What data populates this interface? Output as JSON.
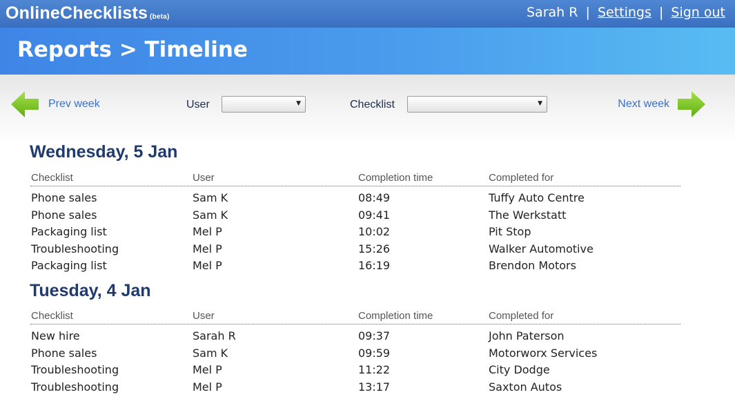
{
  "app": {
    "name": "OnlineChecklists",
    "badge": "(beta)"
  },
  "user_nav": {
    "user": "Sarah R",
    "separator": "|",
    "settings": "Settings",
    "sign_out": "Sign out"
  },
  "page_title": "Reports > Timeline",
  "toolbar": {
    "prev_label": "Prev week",
    "next_label": "Next week",
    "user_label": "User",
    "user_value": "",
    "checklist_label": "Checklist",
    "checklist_value": ""
  },
  "columns": [
    "Checklist",
    "User",
    "Completion time",
    "Completed for"
  ],
  "days": [
    {
      "title": "Wednesday, 5 Jan",
      "rows": [
        [
          "Phone sales",
          "Sam K",
          "08:49",
          "Tuffy Auto Centre"
        ],
        [
          "Phone sales",
          "Sam K",
          "09:41",
          "The Werkstatt"
        ],
        [
          "Packaging list",
          "Mel P",
          "10:02",
          "Pit Stop"
        ],
        [
          "Troubleshooting",
          "Mel P",
          "15:26",
          "Walker Automotive"
        ],
        [
          "Packaging list",
          "Mel P",
          "16:19",
          "Brendon Motors"
        ]
      ]
    },
    {
      "title": "Tuesday, 4 Jan",
      "rows": [
        [
          "New hire",
          "Sarah R",
          "09:37",
          "John Paterson"
        ],
        [
          "Phone sales",
          "Sam K",
          "09:59",
          "Motorworx Services"
        ],
        [
          "Troubleshooting",
          "Mel P",
          "11:22",
          "City Dodge"
        ],
        [
          "Troubleshooting",
          "Mel P",
          "13:17",
          "Saxton Autos"
        ]
      ]
    }
  ],
  "colors": {
    "accent": "#3b6fc8",
    "title": "#1f3a6e",
    "arrow": "#7ec820"
  },
  "icons": {
    "prev": "left-arrow-icon",
    "next": "right-arrow-icon",
    "dropdown": "dropdown-caret-icon"
  }
}
